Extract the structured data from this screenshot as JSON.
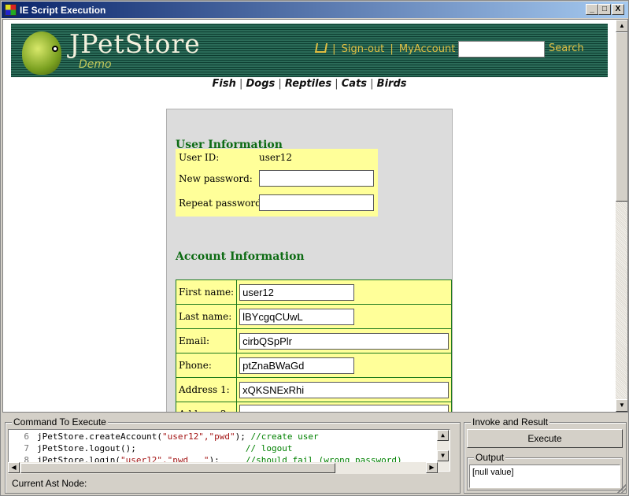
{
  "window": {
    "title": "IE Script Execution",
    "minimize": "_",
    "maximize": "□",
    "close": "X"
  },
  "header": {
    "logo": "JPetStore",
    "logo_sub": "Demo",
    "links": [
      "|",
      "Sign-out",
      "|",
      "MyAccount",
      "|",
      "?"
    ],
    "search_value": "",
    "search_label": "Search"
  },
  "categories": [
    "Fish",
    "Dogs",
    "Reptiles",
    "Cats",
    "Birds"
  ],
  "user_info": {
    "title": "User Information",
    "user_id_label": "User ID:",
    "user_id_value": "user12",
    "new_password_label": "New password:",
    "new_password_value": "",
    "repeat_password_label": "Repeat password:",
    "repeat_password_value": ""
  },
  "account_info": {
    "title": "Account Information",
    "rows": [
      {
        "label": "First name:",
        "value": "user12"
      },
      {
        "label": "Last name:",
        "value": "lBYcgqCUwL"
      },
      {
        "label": "Email:",
        "value": "cirbQSpPlr"
      },
      {
        "label": "Phone:",
        "value": "ptZnaBWaGd"
      },
      {
        "label": "Address 1:",
        "value": "xQKSNExRhi"
      },
      {
        "label": "Address 2:",
        "value": ""
      }
    ]
  },
  "command": {
    "title": "Command To Execute",
    "lines": [
      {
        "no": "6",
        "pre": "jPetStore.createAccount(",
        "str": "\"user12\",\"pwd\"",
        "post": ");",
        "comment": " //create user"
      },
      {
        "no": "7",
        "pre": "jPetStore.logout();",
        "str": "",
        "post": "",
        "comment": "                     // logout"
      },
      {
        "no": "8",
        "pre": "jPetStore.login(",
        "str": "\"user12\",\"pwd___\"",
        "post": ");",
        "comment": "     //should fail (wrong password)"
      }
    ],
    "current_ast_label": "Current Ast Node:"
  },
  "invoke": {
    "title": "Invoke and Result",
    "execute_label": "Execute",
    "output_title": "Output",
    "output_value": "[null value]"
  }
}
